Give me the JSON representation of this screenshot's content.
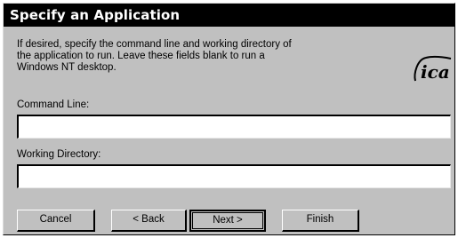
{
  "window": {
    "title": "Specify an Application"
  },
  "description": {
    "line1": "If desired, specify the command line and working directory of",
    "line2": "the application to run.  Leave these fields blank to run a",
    "line3": "Windows NT desktop."
  },
  "logo": {
    "icon": "ica-logo",
    "text": "ica"
  },
  "fields": {
    "command_line": {
      "label": "Command Line:",
      "value": ""
    },
    "working_directory": {
      "label": "Working Directory:",
      "value": ""
    }
  },
  "buttons": {
    "cancel": "Cancel",
    "back": "< Back",
    "next": "Next >",
    "finish": "Finish"
  }
}
